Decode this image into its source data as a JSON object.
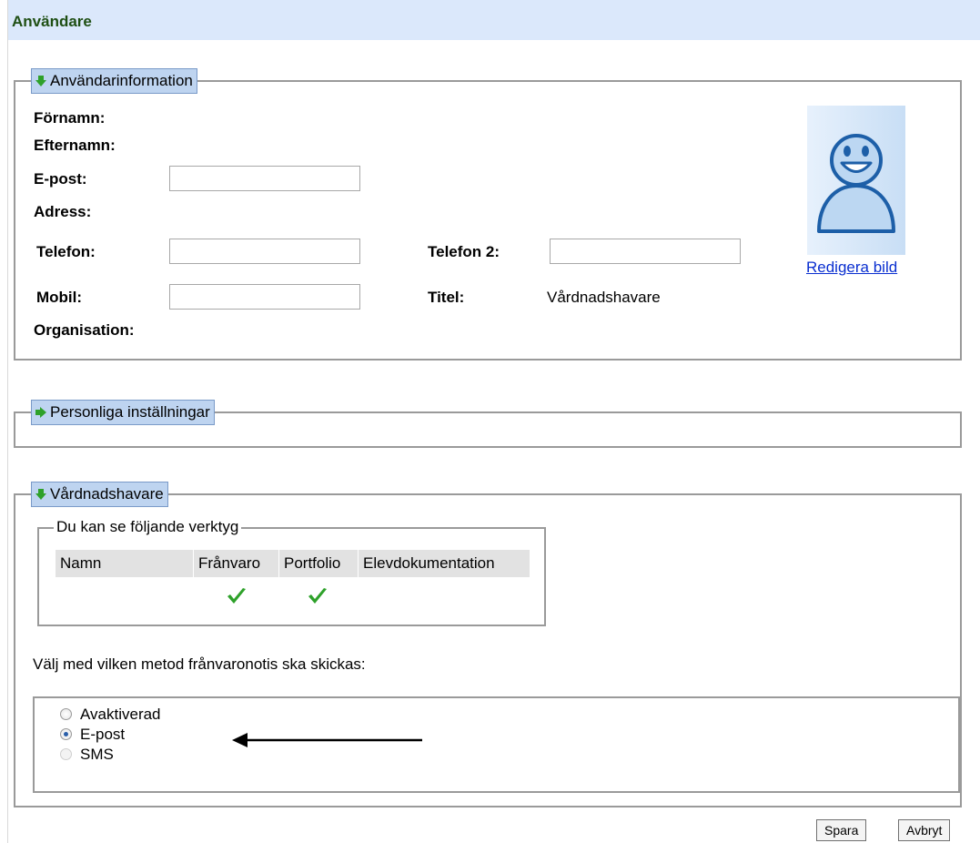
{
  "header": {
    "title": "Användare"
  },
  "user_info": {
    "legend": "Användarinformation",
    "labels": {
      "first_name": "Förnamn:",
      "last_name": "Efternamn:",
      "email": "E-post:",
      "address": "Adress:",
      "phone": "Telefon:",
      "phone2": "Telefon 2:",
      "mobile": "Mobil:",
      "title": "Titel:",
      "organisation": "Organisation:"
    },
    "values": {
      "email": "",
      "phone": "",
      "phone2": "",
      "mobile": "",
      "title": "Vårdnadshavare"
    },
    "avatar_icon": "smiley-person-icon",
    "edit_image_link": "Redigera bild"
  },
  "personal_settings": {
    "legend": "Personliga inställningar"
  },
  "guardian": {
    "legend": "Vårdnadshavare",
    "tools_legend": "Du kan se följande verktyg",
    "tools_columns": [
      "Namn",
      "Frånvaro",
      "Portfolio",
      "Elevdokumentation"
    ],
    "tools_row": {
      "name": "",
      "franvaro": true,
      "portfolio": true,
      "elevdokumentation": false
    },
    "method_label": "Välj med vilken metod frånvaronotis ska skickas:",
    "methods": [
      {
        "label": "Avaktiverad",
        "checked": false,
        "disabled": false
      },
      {
        "label": "E-post",
        "checked": true,
        "disabled": false
      },
      {
        "label": "SMS",
        "checked": false,
        "disabled": true
      }
    ]
  },
  "buttons": {
    "save": "Spara",
    "cancel": "Avbryt"
  },
  "colors": {
    "header_bg": "#dbe8fb",
    "header_text": "#1f4f14",
    "legend_bg": "#bed4f0",
    "check_green": "#2ea12a",
    "link": "#0a2fd0"
  }
}
